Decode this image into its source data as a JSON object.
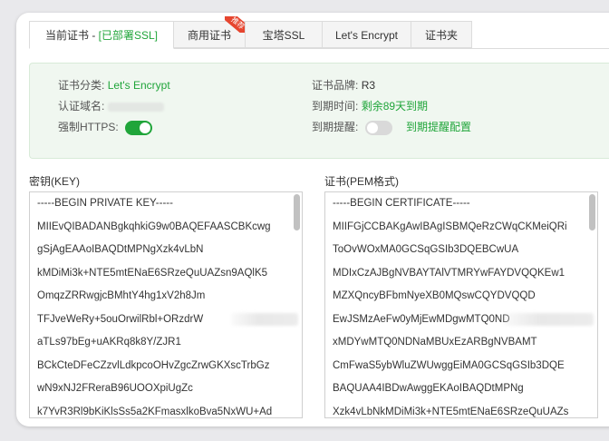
{
  "tabs": [
    {
      "label_prefix": "当前证书 - ",
      "label_highlight": "[已部署SSL]",
      "active": true
    },
    {
      "label": "商用证书",
      "badge": "推荐"
    },
    {
      "label": "宝塔SSL"
    },
    {
      "label": "Let's Encrypt"
    },
    {
      "label": "证书夹"
    }
  ],
  "info": {
    "category_label": "证书分类:",
    "category_value": "Let's Encrypt",
    "domain_label": "认证域名:",
    "https_label": "强制HTTPS:",
    "https_enabled": true,
    "brand_label": "证书品牌:",
    "brand_value": "R3",
    "expiry_label": "到期时间:",
    "expiry_value": "剩余89天到期",
    "reminder_label": "到期提醒:",
    "reminder_enabled": false,
    "reminder_config": "到期提醒配置"
  },
  "key": {
    "title": "密钥(KEY)",
    "lines": [
      "-----BEGIN PRIVATE KEY-----",
      "MIIEvQIBADANBgkqhkiG9w0BAQEFAASCBKcwg",
      "gSjAgEAAoIBAQDtMPNgXzk4vLbN",
      "kMDiMi3k+NTE5mtENaE6SRzeQuUAZsn9AQlK5",
      "OmqzZRRwgjcBMhtY4hg1xV2h8Jm",
      "TFJveWeRy+5ouOrwilRbl+ORzdrW",
      "aTLs97bEg+uAKRq8k8Y/ZJR1",
      "BCkCteDFeCZzvlLdkpcoOHvZgcZrwGKXscTrbGz",
      "wN9xNJ2FReraB96UOOXpiUgZc",
      "k7YvR3Rl9bKiKlsSs5a2KFmasxlkoBva5NxWU+Ad"
    ]
  },
  "cert": {
    "title": "证书(PEM格式)",
    "lines": [
      "-----BEGIN CERTIFICATE-----",
      "MIIFGjCCBAKgAwIBAgISBMQeRzCWqCKMeiQRi",
      "ToOvWOxMA0GCSqGSIb3DQEBCwUA",
      "MDIxCzAJBgNVBAYTAlVTMRYwFAYDVQQKEw1",
      "MZXQncyBFbmNyeXB0MQswCQYDVQQD",
      "EwJSMzAeFw0yMjEwMDgwMTQ0ND",
      "xMDYwMTQ0NDNaMBUxEzARBgNVBAMT",
      "CmFwaS5ybWluZWUwggEiMA0GCSqGSIb3DQE",
      "BAQUAA4IBDwAwggEKAoIBAQDtMPNg",
      "Xzk4vLbNkMDiMi3k+NTE5mtENaE6SRzeQuUAZs"
    ]
  },
  "colors": {
    "accent": "#20a53a",
    "badge": "#e6452f"
  }
}
